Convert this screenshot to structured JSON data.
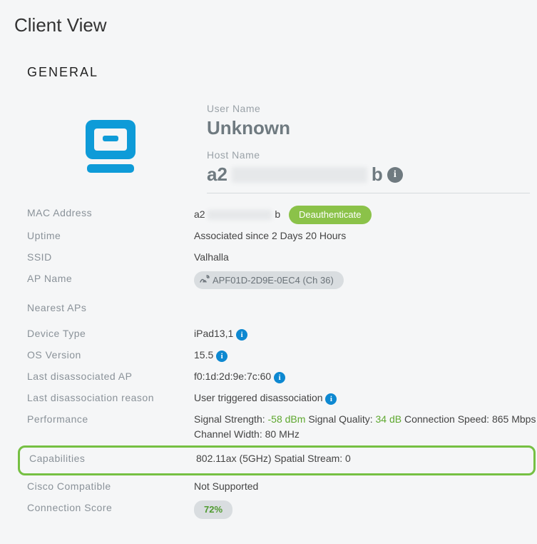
{
  "page_title": "Client View",
  "section_title": "GENERAL",
  "username_label": "User Name",
  "username_value": "Unknown",
  "hostname_label": "Host Name",
  "hostname_prefix": "a2",
  "hostname_suffix": "b",
  "rows": {
    "mac_label": "MAC Address",
    "mac_prefix": "a2",
    "mac_suffix": "b",
    "deauth_label": "Deauthenticate",
    "uptime_label": "Uptime",
    "uptime_value": "Associated since 2 Days 20 Hours",
    "ssid_label": "SSID",
    "ssid_value": "Valhalla",
    "apname_label": "AP Name",
    "apname_value": "APF01D-2D9E-0EC4 (Ch 36)",
    "nearest_label": "Nearest APs",
    "devtype_label": "Device Type",
    "devtype_value": "iPad13,1",
    "os_label": "OS Version",
    "os_value": "15.5",
    "lastap_label": "Last disassociated AP",
    "lastap_value": "f0:1d:2d:9e:7c:60",
    "lastreason_label": "Last disassociation reason",
    "lastreason_value": "User triggered disassociation",
    "perf_label": "Performance",
    "perf_sigstr_label": "Signal Strength: ",
    "perf_sigstr_value": "-58 dBm",
    "perf_sigqual_label": " Signal Quality: ",
    "perf_sigqual_value": "34 dB",
    "perf_rest": " Connection Speed: 865 Mbps Channel Width: 80 MHz",
    "cap_label": "Capabilities",
    "cap_value": "802.11ax (5GHz) Spatial Stream: 0",
    "cisco_label": "Cisco Compatible",
    "cisco_value": "Not Supported",
    "score_label": "Connection Score",
    "score_value": "72%"
  }
}
